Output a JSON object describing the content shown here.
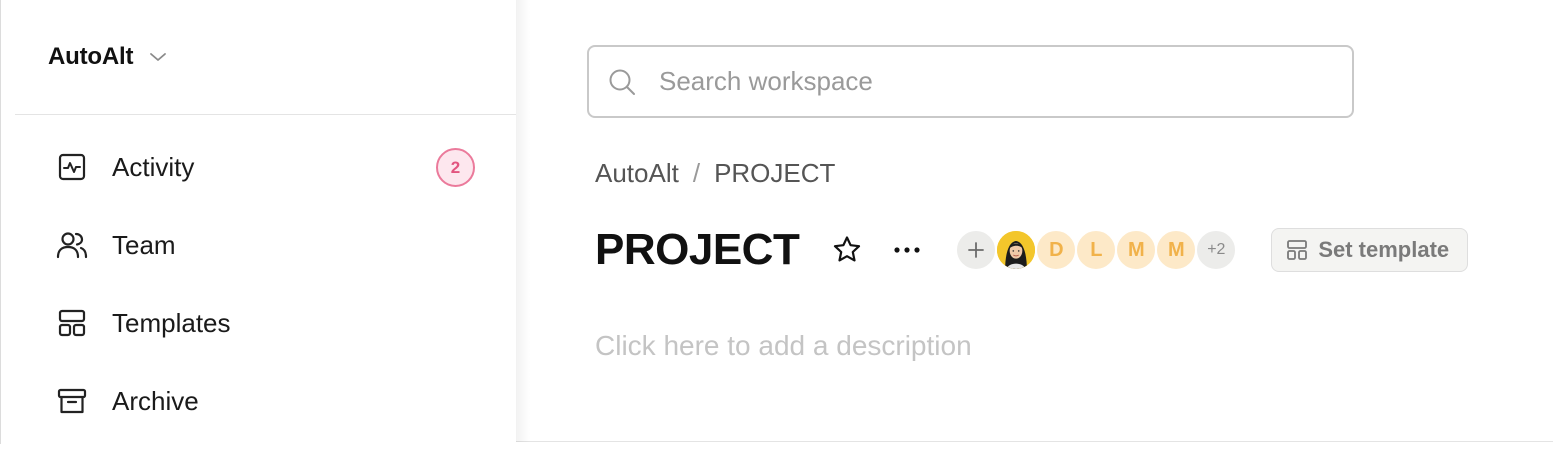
{
  "sidebar": {
    "workspace_name": "AutoAlt",
    "items": [
      {
        "label": "Activity",
        "icon": "activity-icon",
        "badge": "2"
      },
      {
        "label": "Team",
        "icon": "team-icon"
      },
      {
        "label": "Templates",
        "icon": "templates-icon"
      },
      {
        "label": "Archive",
        "icon": "archive-icon"
      }
    ]
  },
  "search": {
    "placeholder": "Search workspace"
  },
  "breadcrumb": {
    "workspace": "AutoAlt",
    "separator": "/",
    "project": "PROJECT"
  },
  "project": {
    "title": "PROJECT",
    "members": [
      "D",
      "L",
      "M",
      "M"
    ],
    "members_more": "+2",
    "set_template_label": "Set template",
    "description_placeholder": "Click here to add a description"
  },
  "colors": {
    "badge_border": "#eb7a9b",
    "badge_text": "#e2557f",
    "avatar_bg": "#fde9c8",
    "avatar_text": "#f1b24a"
  }
}
